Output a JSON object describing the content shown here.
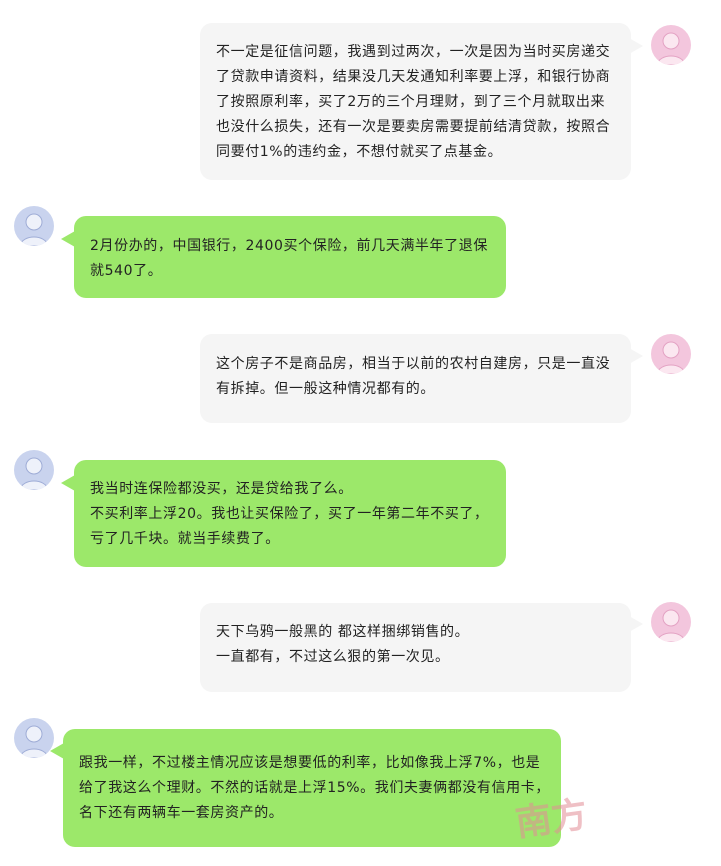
{
  "colors": {
    "self_bubble": "#f5f5f5",
    "other_bubble": "#9ce86a",
    "self_avatar": "#f3c6dd",
    "other_avatar": "#c9d3ee"
  },
  "messages": [
    {
      "side": "self",
      "lines": [
        "不一定是征信问题，我遇到过两次，一次是因为当时买房递交",
        "了贷款申请资料，结果没几天发通知利率要上浮，和银行协商",
        "了按照原利率，买了2万的三个月理财，到了三个月就取出来",
        "也没什么损失，还有一次是要卖房需要提前结清贷款，按照合",
        "同要付1%的违约金，不想付就买了点基金。"
      ]
    },
    {
      "side": "other",
      "lines": [
        "2月份办的，中国银行，2400买个保险，前几天满半年了退保",
        "就540了。"
      ]
    },
    {
      "side": "self",
      "lines": [
        "这个房子不是商品房，相当于以前的农村自建房，只是一直没",
        "有拆掉。但一般这种情况都有的。"
      ]
    },
    {
      "side": "other",
      "lines": [
        "我当时连保险都没买，还是贷给我了么。",
        "不买利率上浮20。我也让买保险了，买了一年第二年不买了，",
        "亏了几千块。就当手续费了。"
      ]
    },
    {
      "side": "self",
      "lines": [
        "天下乌鸦一般黑的 都这样捆绑销售的。",
        "一直都有，不过这么狠的第一次见。"
      ]
    },
    {
      "side": "other",
      "lines": [
        "跟我一样，不过楼主情况应该是想要低的利率，比如像我上浮7%，也是",
        "给了我这么个理财。不然的话就是上浮15%。我们夫妻俩都没有信用卡，",
        "名下还有两辆车一套房资产的。"
      ]
    }
  ],
  "watermark": "南方"
}
